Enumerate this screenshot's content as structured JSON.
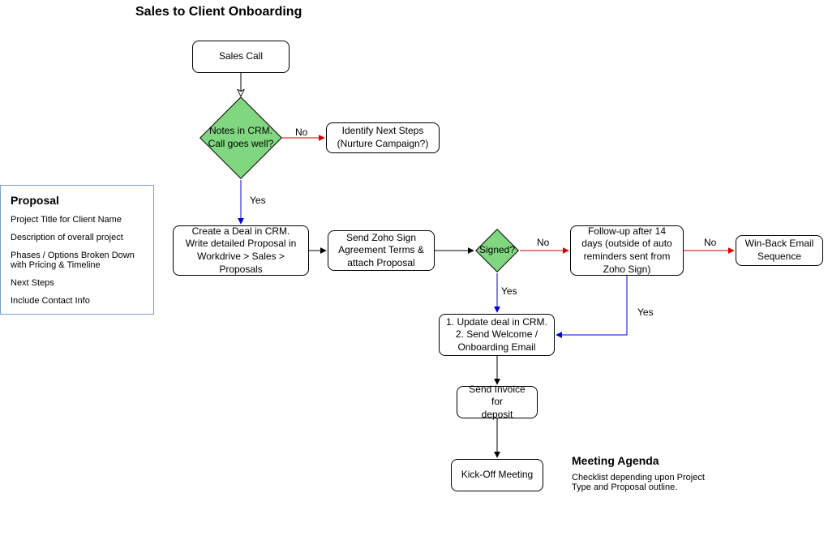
{
  "title": "Sales to Client Onboarding",
  "nodes": {
    "sales_call": "Sales Call",
    "decision_notes": "Notes in CRM.\nCall goes well?",
    "identify_next": "Identify Next Steps\n(Nurture Campaign?)",
    "create_deal": "Create a Deal in CRM.\nWrite detailed Proposal in\nWorkdrive > Sales >\nProposals",
    "send_zoho": "Send Zoho Sign\nAgreement Terms &\nattach Proposal",
    "decision_signed": "Signed?",
    "followup": "Follow-up after 14\ndays (outside of auto\nreminders sent from\nZoho Sign)",
    "winback": "Win-Back Email\nSequence",
    "update_deal": "1. Update deal in CRM.\n2. Send Welcome /\nOnboarding Email",
    "send_invoice": "Send Invoice for\ndeposit",
    "kickoff": "Kick-Off Meeting"
  },
  "edges": {
    "no": "No",
    "yes": "Yes"
  },
  "proposal_note": {
    "title": "Proposal",
    "items": [
      "Project Title for Client Name",
      "Description of overall project",
      "Phases / Options Broken Down with Pricing & Timeline",
      "Next Steps",
      "Include Contact Info"
    ]
  },
  "meeting_note": {
    "title": "Meeting Agenda",
    "body": "Checklist depending upon Project Type and Proposal outline."
  }
}
